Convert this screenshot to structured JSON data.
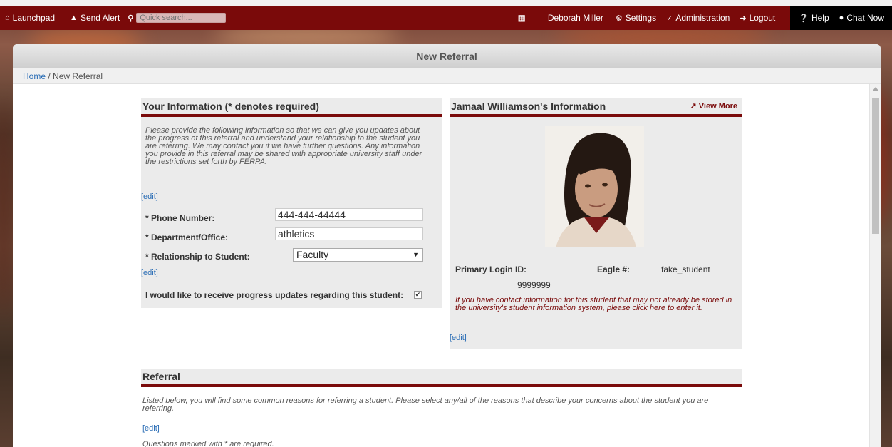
{
  "nav": {
    "launchpad": "Launchpad",
    "send_alert": "Send Alert",
    "search_placeholder": "Quick search...",
    "user_name": "Deborah Miller",
    "settings": "Settings",
    "administration": "Administration",
    "logout": "Logout",
    "help": "Help",
    "chat_now": "Chat Now"
  },
  "panel": {
    "title": "New Referral",
    "breadcrumb_home": "Home",
    "breadcrumb_sep": " / ",
    "breadcrumb_current": "New Referral"
  },
  "your_info": {
    "title": "Your Information (* denotes required)",
    "intro": "Please provide the following information so that we can give you updates about the progress of this referral and understand your relationship to the student you are referring. We may contact you if we have further questions. Any information you provide in this referral may be shared with appropriate university staff under the restrictions set forth by FERPA.",
    "edit1": "[edit]",
    "phone_label": "* Phone Number:",
    "phone_value": "444-444-44444",
    "dept_label": "* Department/Office:",
    "dept_value": "athletics",
    "rel_label": "* Relationship to Student:",
    "rel_value": "Faculty",
    "edit2": "[edit]",
    "progress_label": "I would like to receive progress updates regarding this student:",
    "progress_checked": true
  },
  "student_info": {
    "title": "Jamaal Williamson's Information",
    "view_more": "View More",
    "login_label": "Primary Login ID:",
    "eagle_label": "Eagle #:",
    "login_value": "fake_student",
    "eagle_value": "9999999",
    "contact_note": "If you have contact information for this student that may not already be stored in the university's student information system, please click here to enter it.",
    "edit": "[edit]"
  },
  "referral": {
    "title": "Referral",
    "intro": "Listed below, you will find some common reasons for referring a student. Please select any/all of the reasons that describe your concerns about the student you are referring.",
    "edit": "[edit]",
    "required_note": "Questions marked with * are required."
  },
  "colors": {
    "brand_maroon": "#7a0a0a",
    "link_blue": "#2a6db5"
  }
}
